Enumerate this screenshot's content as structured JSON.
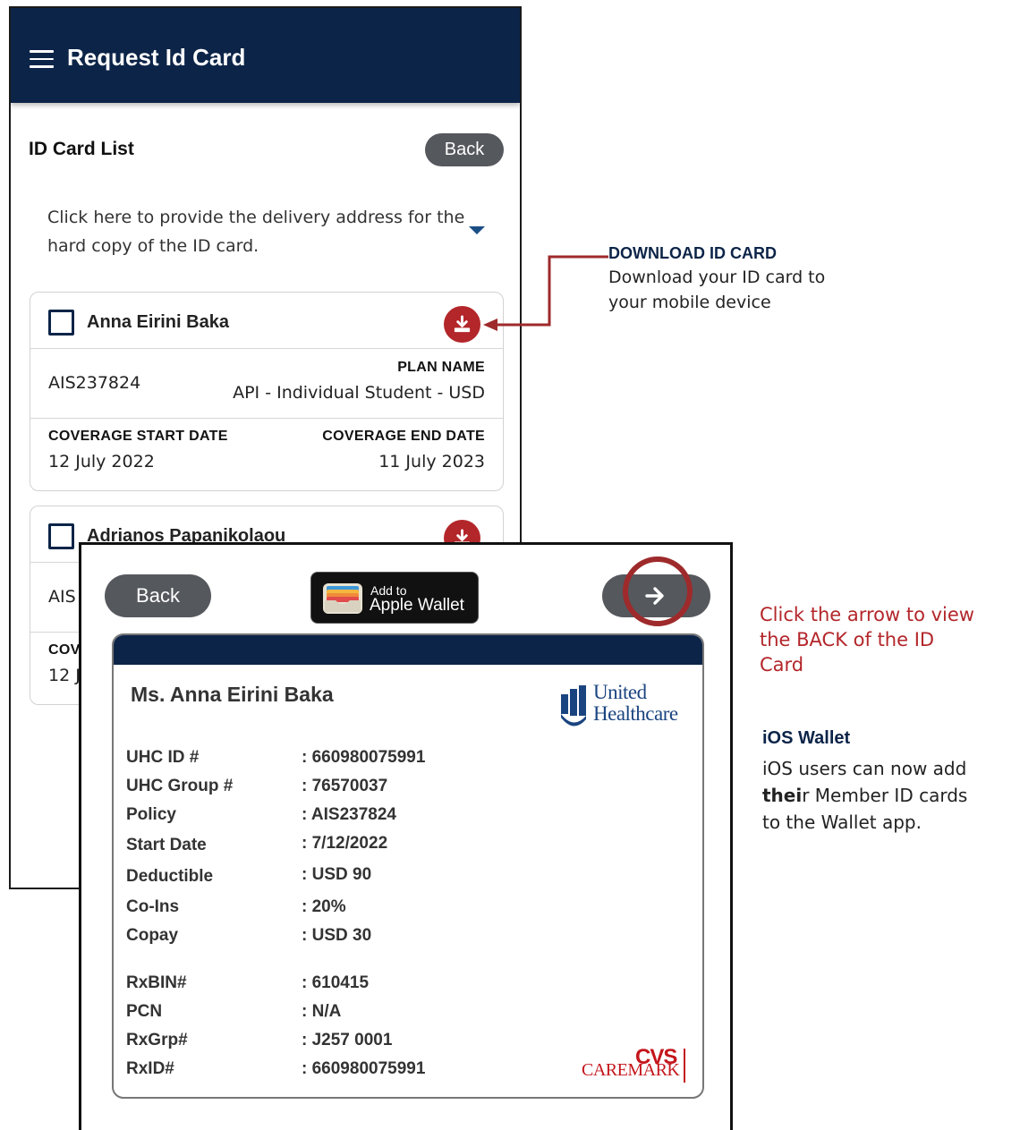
{
  "app": {
    "title": "Request Id Card",
    "list_title": "ID Card List",
    "back_label": "Back",
    "delivery_prompt": "Click here to provide the delivery address for the hard copy of the ID card."
  },
  "cards": [
    {
      "name": "Anna Eirini Baka",
      "policy_id": "AIS237824",
      "plan_label": "PLAN NAME",
      "plan_name": "API - Individual Student - USD",
      "start_label": "COVERAGE START DATE",
      "start_date": "12 July 2022",
      "end_label": "COVERAGE END DATE",
      "end_date": "11 July 2023"
    },
    {
      "name": "Adrianos Papanikolaou",
      "policy_id_partial": "AIS",
      "start_label_partial": "COV",
      "start_date_partial": "12 J"
    }
  ],
  "annotations": {
    "download_title": "DOWNLOAD ID CARD",
    "download_line1": "Download your ID card to",
    "download_line2": "your mobile device",
    "arrow_hint": "Click the arrow to view the BACK of the ID Card",
    "ios_title": "iOS Wallet",
    "ios_line1": "iOS users can now add",
    "ios_bold": "thei",
    "ios_line2_rest": "r Member ID cards",
    "ios_line3": "to the Wallet app."
  },
  "viewer": {
    "back_label": "Back",
    "wallet_add": "Add to",
    "wallet_main": "Apple Wallet"
  },
  "id_card": {
    "holder": "Ms. Anna Eirini Baka",
    "insurer_line1": "United",
    "insurer_line2": "Healthcare",
    "fields": [
      {
        "label": "UHC ID #",
        "value": ": 660980075991"
      },
      {
        "label": "UHC Group #",
        "value": ": 76570037"
      },
      {
        "label": "Policy",
        "value": ": AIS237824"
      },
      {
        "label": "Start Date",
        "value": ": 7/12/2022"
      },
      {
        "label": "Deductible",
        "value": ": USD 90"
      },
      {
        "label": "Co-Ins",
        "value": ": 20%"
      },
      {
        "label": "Copay",
        "value": ": USD 30"
      },
      {
        "label": "RxBIN#",
        "value": ": 610415"
      },
      {
        "label": "PCN",
        "value": ": N/A"
      },
      {
        "label": "RxGrp#",
        "value": ": J257 0001"
      },
      {
        "label": "RxID#",
        "value": ": 660980075991"
      }
    ],
    "pharmacy_top": "CVS",
    "pharmacy_bottom": "CAREMARK"
  },
  "colors": {
    "navy": "#0c2448",
    "accent_red": "#b3262a",
    "button_gray": "#55585d",
    "cvs_red": "#c4161c"
  },
  "icons": [
    "menu-icon",
    "download-icon",
    "chevron-down-icon",
    "arrow-right-icon",
    "wallet-icon",
    "uhc-logo-icon"
  ]
}
